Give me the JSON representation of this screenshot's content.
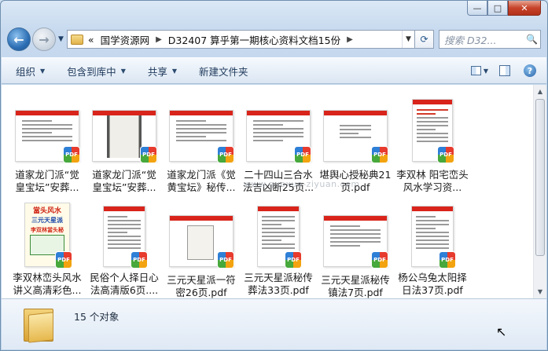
{
  "window": {
    "caption": {
      "minimize": "—",
      "maximize": "□",
      "close": "✕"
    }
  },
  "address": {
    "chevron": "«",
    "crumbs": [
      "国学资源网",
      "D32407 算乎第一期核心资料文档15份"
    ],
    "separator": "▶",
    "dropdown": "▼",
    "refresh": "⟳"
  },
  "search": {
    "placeholder": "搜索 D32...",
    "icon": "search-icon"
  },
  "toolbar": {
    "organize": "组织",
    "include": "包含到库中",
    "share": "共享",
    "new_folder": "新建文件夹",
    "dropdown_arrow": "▼",
    "help": "?"
  },
  "files": [
    {
      "label": "道家龙门派“觉皇宝坛”安葬...",
      "thumb": "doc"
    },
    {
      "label": "道家龙门派“觉皇宝坛”安葬...",
      "thumb": "scan"
    },
    {
      "label": "道家龙门派《觉黄宝坛》秘传...",
      "thumb": "doc"
    },
    {
      "label": "二十四山三合水法吉凶断25页...",
      "thumb": "doc"
    },
    {
      "label": "堪舆心授秘典21页.pdf",
      "thumb": "doc"
    },
    {
      "label": "李双林 阳宅峦头风水学习资...",
      "thumb": "red"
    },
    {
      "label": "李双林峦头风水讲义高清彩色...",
      "thumb": "poster"
    },
    {
      "label": "民俗个人择日心法高清版6页....",
      "thumb": "doc"
    },
    {
      "label": "三元天星派一符密26页.pdf",
      "thumb": "scan2"
    },
    {
      "label": "三元天星派秘传葬法33页.pdf",
      "thumb": "doc"
    },
    {
      "label": "三元天星派秘传镇法7页.pdf",
      "thumb": "doc"
    },
    {
      "label": "杨公乌兔太阳择日法37页.pdf",
      "thumb": "doc"
    }
  ],
  "pdf_badge": "PDF",
  "watermark": "www.guoxue-ziyuan.com",
  "poster": {
    "line1": "當头风水",
    "line2": "三元天星派",
    "line3": "李双林當头秘诀"
  },
  "status": {
    "count": "15 个对象"
  },
  "colors": {
    "accent": "#2d6fb5",
    "pdf_red": "#d9241b",
    "toolbar_text": "#1e395b"
  }
}
